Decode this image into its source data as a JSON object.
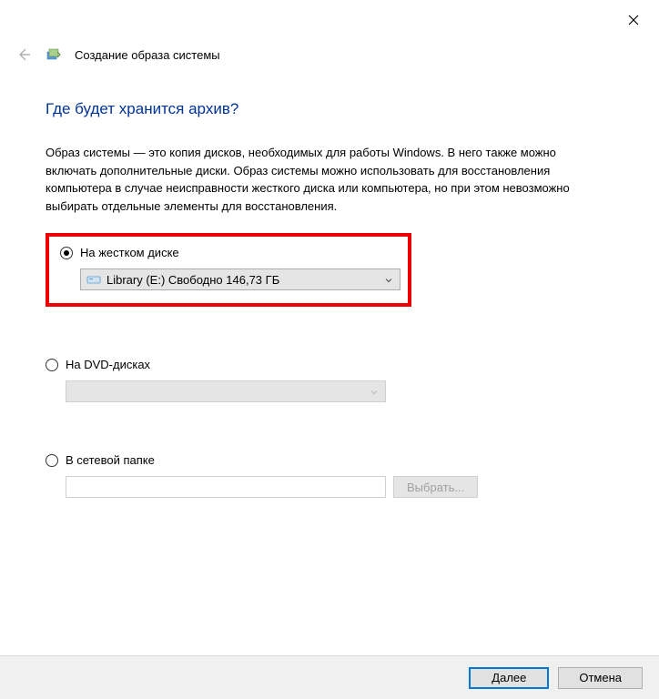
{
  "window": {
    "title": "Создание образа системы"
  },
  "heading": "Где будет хранится архив?",
  "description": "Образ системы — это копия дисков, необходимых для работы Windows. В него также можно включать дополнительные диски. Образ системы можно использовать для восстановления компьютера в случае неисправности жесткого диска или компьютера, но при этом невозможно выбирать отдельные элементы для восстановления.",
  "options": {
    "hard_disk": {
      "label": "На жестком диске",
      "selected_value": "Library (E:)  Свободно 146,73 ГБ"
    },
    "dvd": {
      "label": "На DVD-дисках"
    },
    "network": {
      "label": "В сетевой папке",
      "browse_label": "Выбрать..."
    }
  },
  "footer": {
    "next": "Далее",
    "cancel": "Отмена"
  }
}
